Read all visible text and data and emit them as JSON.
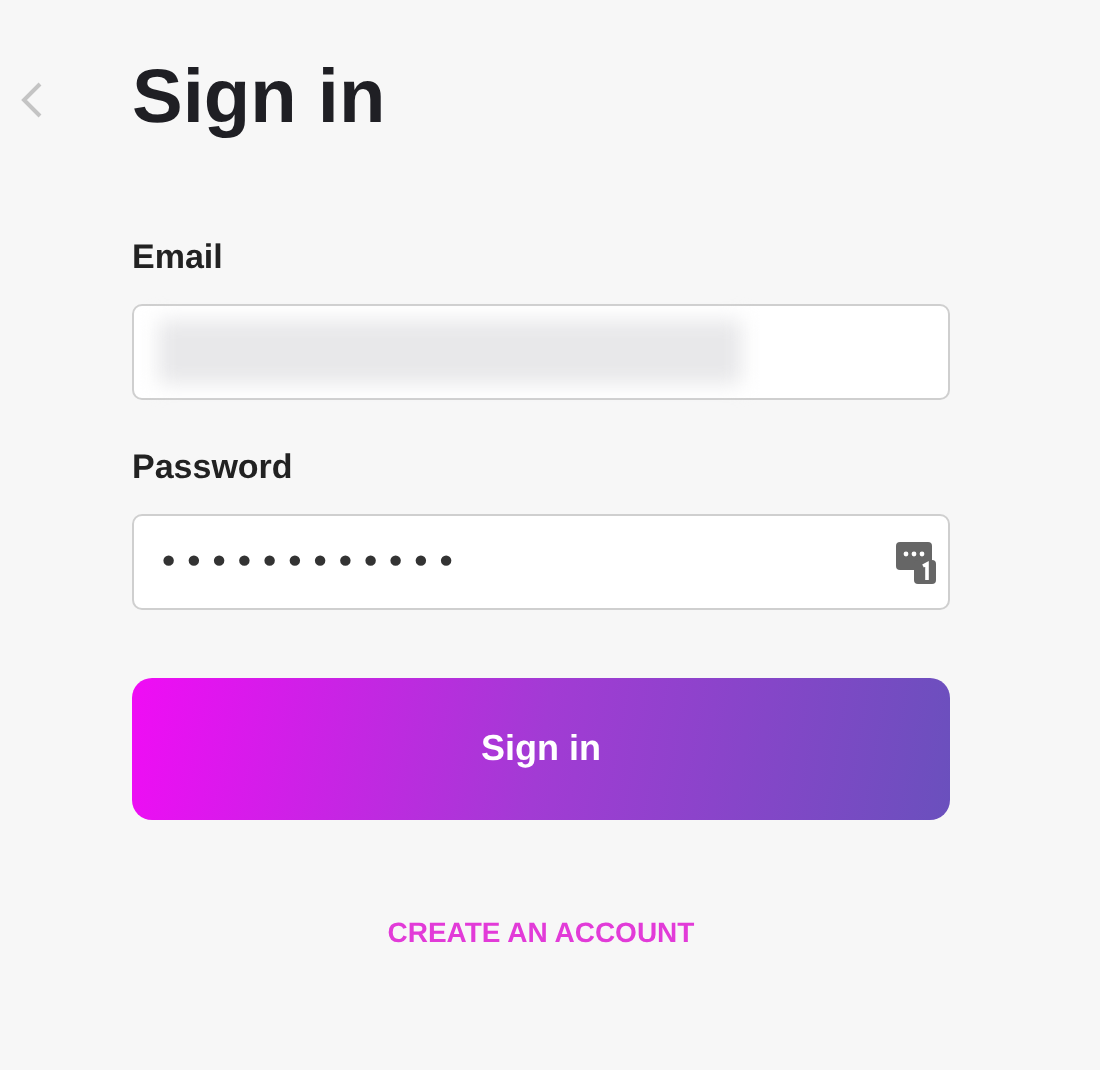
{
  "title": "Sign in",
  "fields": [
    {
      "label": "Email",
      "kind": "redacted"
    },
    {
      "label": "Password",
      "kind": "password",
      "value": "••••••••••••"
    }
  ],
  "submit": "Sign in",
  "create_account": "CREATE AN ACCOUNT"
}
